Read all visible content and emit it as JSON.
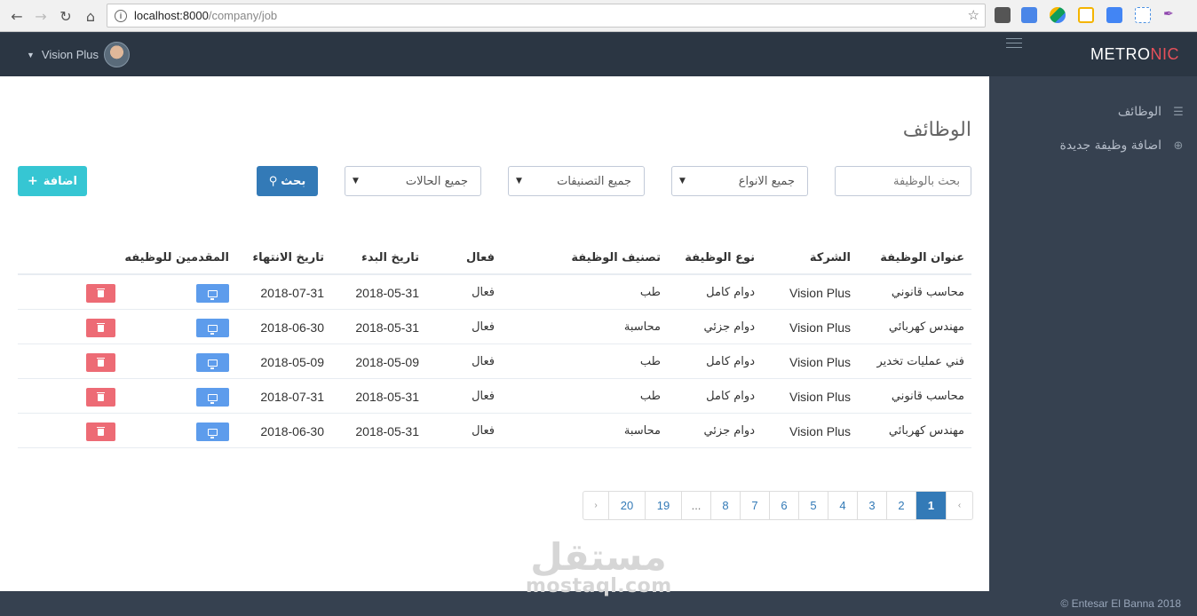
{
  "browser": {
    "url_host": "localhost:8000",
    "url_path": "/company/job"
  },
  "header": {
    "logo_main": "METRO",
    "logo_accent": "NIC",
    "user_name": "Vision Plus"
  },
  "sidebar": {
    "items": [
      {
        "label": "الوظائف",
        "icon": "list-icon"
      },
      {
        "label": "اضافة وظيفة جديدة",
        "icon": "plus-circle-icon"
      }
    ]
  },
  "page": {
    "title": "الوظائف",
    "search_placeholder": "بحث بالوظيفة",
    "filter_types": "جميع الانواع",
    "filter_categories": "جميع التصنيفات",
    "filter_statuses": "جميع الحالات",
    "search_button": "بحث",
    "add_button": "اضافة"
  },
  "table": {
    "headers": {
      "title": "عنوان الوظيفة",
      "company": "الشركة",
      "type": "نوع الوظيفة",
      "category": "تصنيف الوظيفة",
      "active": "فعال",
      "start": "تاريخ البدء",
      "end": "تاريخ الانتهاء",
      "applicants": "المقدمين للوظيفه"
    },
    "rows": [
      {
        "title": "محاسب قانوني",
        "company": "Vision Plus",
        "type": "دوام كامل",
        "category": "طب",
        "active": "فعال",
        "start": "2018-05-31",
        "end": "2018-07-31"
      },
      {
        "title": "مهندس كهربائي",
        "company": "Vision Plus",
        "type": "دوام جزئي",
        "category": "محاسبة",
        "active": "فعال",
        "start": "2018-05-31",
        "end": "2018-06-30"
      },
      {
        "title": "فني عمليات تخدير",
        "company": "Vision Plus",
        "type": "دوام كامل",
        "category": "طب",
        "active": "فعال",
        "start": "2018-05-09",
        "end": "2018-05-09"
      },
      {
        "title": "محاسب قانوني",
        "company": "Vision Plus",
        "type": "دوام كامل",
        "category": "طب",
        "active": "فعال",
        "start": "2018-05-31",
        "end": "2018-07-31"
      },
      {
        "title": "مهندس كهربائي",
        "company": "Vision Plus",
        "type": "دوام جزئي",
        "category": "محاسبة",
        "active": "فعال",
        "start": "2018-05-31",
        "end": "2018-06-30"
      }
    ]
  },
  "pagination": {
    "prev": "›",
    "next": "‹",
    "pages": [
      "20",
      "19",
      "...",
      "8",
      "7",
      "6",
      "5",
      "4",
      "3",
      "2",
      "1"
    ],
    "active": "1"
  },
  "watermark": {
    "arabic": "مستقل",
    "latin": "mostaql.com"
  },
  "footer": {
    "text": "© Entesar El Banna 2018"
  },
  "colors": {
    "header_bg": "#2b3643",
    "sidebar_bg": "#364150",
    "primary": "#337ab7",
    "add_button": "#36c6d3",
    "view_button": "#5d9cec",
    "delete_button": "#ed6b75",
    "logo_accent": "#e7505a"
  }
}
